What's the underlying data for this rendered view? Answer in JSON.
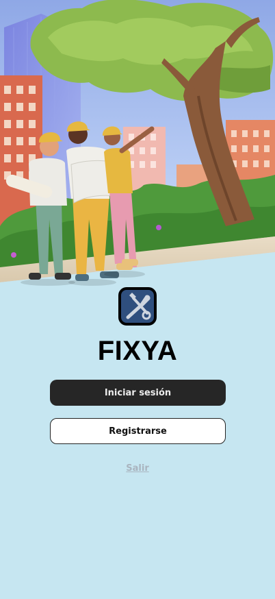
{
  "app": {
    "name": "FIXYA"
  },
  "buttons": {
    "login_label": "Iniciar sesión",
    "register_label": "Registrarse",
    "exit_label": "Salir"
  },
  "colors": {
    "background": "#c6e6f1",
    "primary_button": "#262626",
    "secondary_button": "#ffffff",
    "link_muted": "#a9b4bf"
  },
  "icons": {
    "logo": "tools-icon",
    "hero": "construction-workers-illustration"
  }
}
